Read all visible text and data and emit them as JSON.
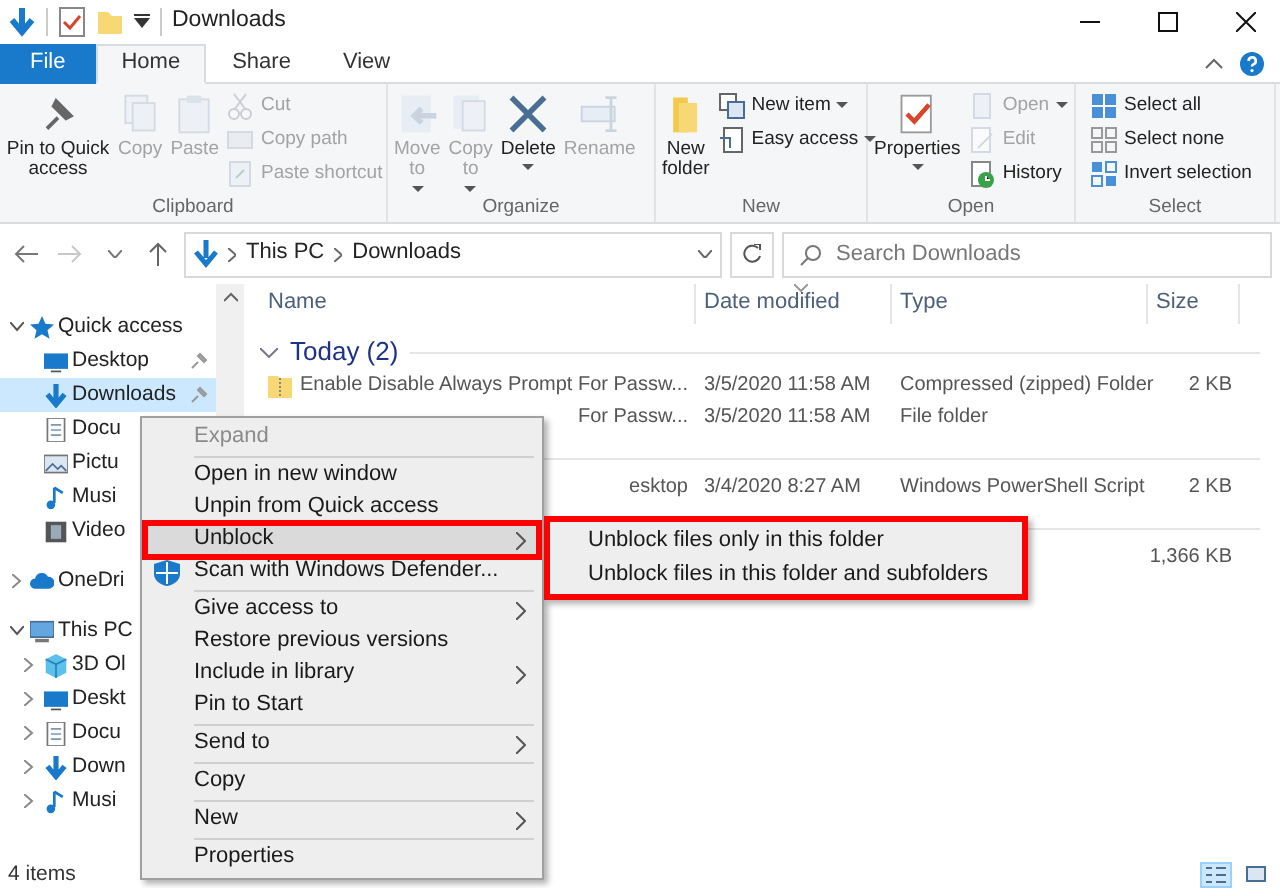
{
  "title_bar": {
    "title": "Downloads"
  },
  "ribbon_tabs": [
    {
      "label": "File",
      "kind": "file",
      "selected": false
    },
    {
      "label": "Home",
      "kind": "tab",
      "selected": true
    },
    {
      "label": "Share",
      "kind": "tab",
      "selected": false
    },
    {
      "label": "View",
      "kind": "tab",
      "selected": false
    }
  ],
  "ribbon_groups": [
    {
      "label": "Clipboard",
      "large": [
        {
          "label": "Pin to Quick access",
          "disabled": false,
          "dropdown": false
        },
        {
          "label": "Copy",
          "disabled": true,
          "dropdown": false
        },
        {
          "label": "Paste",
          "disabled": true,
          "dropdown": false
        }
      ],
      "small": [
        {
          "label": "Cut",
          "disabled": true,
          "dropdown": false
        },
        {
          "label": "Copy path",
          "disabled": true,
          "dropdown": false
        },
        {
          "label": "Paste shortcut",
          "disabled": true,
          "dropdown": false
        }
      ]
    },
    {
      "label": "Organize",
      "large": [
        {
          "label": "Move to",
          "disabled": true,
          "dropdown": true
        },
        {
          "label": "Copy to",
          "disabled": true,
          "dropdown": true
        },
        {
          "label": "Delete",
          "disabled": false,
          "dropdown": true
        },
        {
          "label": "Rename",
          "disabled": true,
          "dropdown": false
        }
      ]
    },
    {
      "label": "New",
      "large": [
        {
          "label": "New folder",
          "disabled": false,
          "dropdown": false
        }
      ],
      "small": [
        {
          "label": "New item",
          "disabled": false,
          "dropdown": true
        },
        {
          "label": "Easy access",
          "disabled": false,
          "dropdown": true
        }
      ]
    },
    {
      "label": "Open",
      "large": [
        {
          "label": "Properties",
          "disabled": false,
          "dropdown": true
        }
      ],
      "small": [
        {
          "label": "Open",
          "disabled": true,
          "dropdown": true
        },
        {
          "label": "Edit",
          "disabled": true,
          "dropdown": false
        },
        {
          "label": "History",
          "disabled": false,
          "dropdown": false
        }
      ]
    },
    {
      "label": "Select",
      "small": [
        {
          "label": "Select all",
          "disabled": false,
          "dropdown": false
        },
        {
          "label": "Select none",
          "disabled": false,
          "dropdown": false
        },
        {
          "label": "Invert selection",
          "disabled": false,
          "dropdown": false
        }
      ]
    }
  ],
  "address_bar": {
    "back": {
      "disabled": false
    },
    "forward": {
      "disabled": true
    },
    "breadcrumb": [
      "This PC",
      "Downloads"
    ]
  },
  "search": {
    "placeholder": "Search Downloads"
  },
  "nav_pane": {
    "items": [
      {
        "label": "Quick access",
        "kind": "quick",
        "expanded": true,
        "selected": false,
        "children": [
          {
            "label": "Desktop",
            "kind": "desktop",
            "pinned": true,
            "selected": false
          },
          {
            "label": "Downloads",
            "kind": "downloads",
            "pinned": true,
            "selected": true
          },
          {
            "label": "Docu",
            "kind": "documents",
            "selected": false
          },
          {
            "label": "Pictu",
            "kind": "pictures",
            "selected": false
          },
          {
            "label": "Musi",
            "kind": "music",
            "selected": false
          },
          {
            "label": "Video",
            "kind": "videos",
            "selected": false
          }
        ]
      },
      {
        "label": "OneDri",
        "kind": "cloud",
        "expanded": false,
        "selected": false
      },
      {
        "label": "This PC",
        "kind": "pc",
        "expanded": true,
        "selected": false,
        "children": [
          {
            "label": "3D Ol",
            "kind": "objects3d",
            "expanded": false,
            "selected": false
          },
          {
            "label": "Deskt",
            "kind": "desktop",
            "expanded": false,
            "selected": false
          },
          {
            "label": "Docu",
            "kind": "documents",
            "expanded": false,
            "selected": false
          },
          {
            "label": "Down",
            "kind": "downloads",
            "expanded": false,
            "selected": false
          },
          {
            "label": "Musi",
            "kind": "music",
            "expanded": false,
            "selected": false
          }
        ]
      }
    ]
  },
  "file_list": {
    "columns": [
      {
        "label": "Name",
        "sorted": false
      },
      {
        "label": "Date modified",
        "sorted": true
      },
      {
        "label": "Type",
        "sorted": false
      },
      {
        "label": "Size",
        "sorted": false
      }
    ],
    "groups": [
      {
        "label": "Today (2)",
        "rows": [
          {
            "kind": "zip",
            "name": "Enable Disable Always Prompt For Passw...",
            "date": "3/5/2020 11:58 AM",
            "type": "Compressed (zipped) Folder",
            "size": "2 KB"
          },
          {
            "kind": "folder",
            "name": "For Passw...",
            "date": "3/5/2020 11:58 AM",
            "type": "File folder"
          }
        ]
      },
      {
        "rows": [
          {
            "kind": "script",
            "name": "esktop",
            "date": "3/4/2020 8:27 AM",
            "type": "Windows PowerShell Script",
            "size": "2 KB"
          }
        ]
      },
      {
        "rows": [
          {
            "kind": "file",
            "size": "1,366 KB"
          }
        ]
      }
    ]
  },
  "context_menu": {
    "items": [
      {
        "kind": "item",
        "label": "Expand",
        "disabled": true,
        "submenu": false,
        "highlighted": false
      },
      {
        "kind": "separator"
      },
      {
        "kind": "item",
        "label": "Open in new window",
        "disabled": false,
        "submenu": false,
        "highlighted": false
      },
      {
        "kind": "item",
        "label": "Unpin from Quick access",
        "disabled": false,
        "submenu": false,
        "highlighted": false
      },
      {
        "kind": "item",
        "label": "Unblock",
        "disabled": false,
        "submenu": true,
        "highlighted": true
      },
      {
        "kind": "icon_item",
        "label": "Scan with Windows Defender...",
        "disabled": false,
        "submenu": false,
        "highlighted": false
      },
      {
        "kind": "separator"
      },
      {
        "kind": "item",
        "label": "Give access to",
        "disabled": false,
        "submenu": true,
        "highlighted": false
      },
      {
        "kind": "item",
        "label": "Restore previous versions",
        "disabled": false,
        "submenu": false,
        "highlighted": false
      },
      {
        "kind": "item",
        "label": "Include in library",
        "disabled": false,
        "submenu": true,
        "highlighted": false
      },
      {
        "kind": "item",
        "label": "Pin to Start",
        "disabled": false,
        "submenu": false,
        "highlighted": false
      },
      {
        "kind": "separator"
      },
      {
        "kind": "item",
        "label": "Send to",
        "disabled": false,
        "submenu": true,
        "highlighted": false
      },
      {
        "kind": "separator"
      },
      {
        "kind": "item",
        "label": "Copy",
        "disabled": false,
        "submenu": false,
        "highlighted": false
      },
      {
        "kind": "separator"
      },
      {
        "kind": "item",
        "label": "New",
        "disabled": false,
        "submenu": true,
        "highlighted": false
      },
      {
        "kind": "separator"
      },
      {
        "kind": "item",
        "label": "Properties",
        "disabled": false,
        "submenu": false,
        "highlighted": false
      }
    ]
  },
  "submenu": {
    "items": [
      {
        "label": "Unblock files only in this folder"
      },
      {
        "label": "Unblock files in this folder and subfolders"
      }
    ]
  },
  "status_bar": {
    "text": "4 items",
    "views": [
      {
        "selected": true
      },
      {
        "selected": false
      }
    ]
  }
}
